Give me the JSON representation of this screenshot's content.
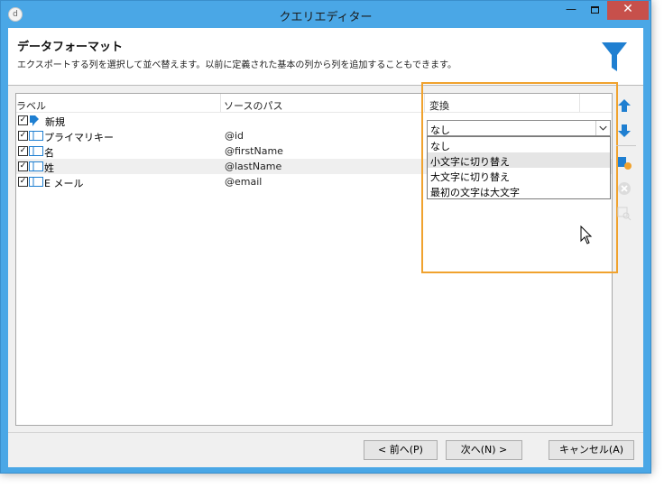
{
  "window": {
    "title": "クエリエディター",
    "app_icon": "d"
  },
  "header": {
    "title": "データフォーマット",
    "subtitle": "エクスポートする列を選択して並べ替えます。以前に定義された基本の列から列を追加することもできます。",
    "icon": "funnel-icon"
  },
  "columns": {
    "label": "ラベル",
    "source": "ソースのパス",
    "transform": "変換"
  },
  "rows": [
    {
      "label": "新規",
      "path": "",
      "checked": true,
      "icon": "new-node-icon"
    },
    {
      "label": "プライマリキー",
      "path": "@id",
      "checked": true,
      "icon": "field-icon"
    },
    {
      "label": "名",
      "path": "@firstName",
      "checked": true,
      "icon": "field-icon"
    },
    {
      "label": "姓",
      "path": "@lastName",
      "checked": true,
      "icon": "field-icon",
      "selected": true
    },
    {
      "label": "E メール",
      "path": "@email",
      "checked": true,
      "icon": "field-icon"
    }
  ],
  "transform_combo": {
    "value": "なし",
    "options": [
      "なし",
      "小文字に切り替え",
      "大文字に切り替え",
      "最初の文字は大文字"
    ],
    "hovered_option": "小文字に切り替え"
  },
  "side_toolbar": [
    "move-up-icon",
    "move-down-icon",
    "add-column-icon",
    "delete-icon",
    "detail-icon"
  ],
  "buttons": {
    "prev": "< 前へ(P)",
    "next": "次へ(N) >",
    "cancel": "キャンセル(A)"
  },
  "colors": {
    "titlebar": "#4aa7e6",
    "close": "#c7504b",
    "highlight": "#f0a22e",
    "accent_blue": "#1f7fd1"
  }
}
